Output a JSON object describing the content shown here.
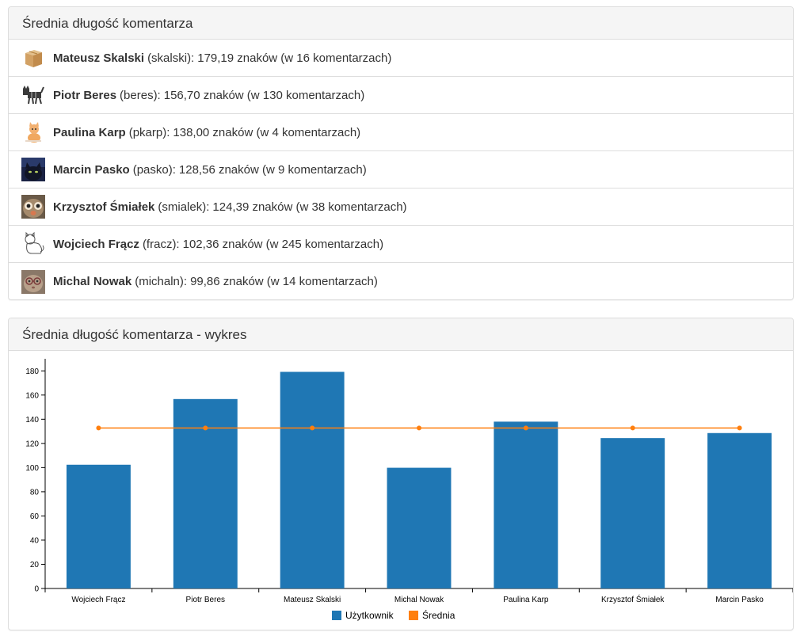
{
  "list_panel": {
    "title": "Średnia długość komentarza",
    "items": [
      {
        "name": "Mateusz Skalski",
        "login": "(skalski):",
        "stats": "179,19 znaków (w 16 komentarzach)",
        "avatar": "box-avatar-icon"
      },
      {
        "name": "Piotr Beres",
        "login": "(beres):",
        "stats": "156,70 znaków (w 130 komentarzach)",
        "avatar": "cat-avatar-icon"
      },
      {
        "name": "Paulina Karp",
        "login": "(pkarp):",
        "stats": "138,00 znaków (w 4 komentarzach)",
        "avatar": "kitten-avatar-icon"
      },
      {
        "name": "Marcin Pasko",
        "login": "(pasko):",
        "stats": "128,56 znaków (w 9 komentarzach)",
        "avatar": "dark-cat-avatar-icon"
      },
      {
        "name": "Krzysztof Śmiałek",
        "login": "(smialek):",
        "stats": "124,39 znaków (w 38 komentarzach)",
        "avatar": "owl-avatar-icon"
      },
      {
        "name": "Wojciech Frącz",
        "login": "(fracz):",
        "stats": "102,36 znaków (w 245 komentarzach)",
        "avatar": "sketch-cat-avatar-icon"
      },
      {
        "name": "Michal Nowak",
        "login": "(michaln):",
        "stats": "99,86 znaków (w 14 komentarzach)",
        "avatar": "glasses-cat-avatar-icon"
      }
    ]
  },
  "chart_panel": {
    "title": "Średnia długość komentarza - wykres"
  },
  "chart_data": {
    "type": "bar",
    "categories": [
      "Wojciech Frącz",
      "Piotr Beres",
      "Mateusz Skalski",
      "Michal Nowak",
      "Paulina Karp",
      "Krzysztof Śmiałek",
      "Marcin Pasko"
    ],
    "series": [
      {
        "name": "Użytkownik",
        "type": "bar",
        "color": "#1f77b4",
        "values": [
          102.36,
          156.7,
          179.19,
          99.86,
          138.0,
          124.39,
          128.56
        ]
      },
      {
        "name": "Średnia",
        "type": "line",
        "color": "#ff7f0e",
        "values": [
          132.72,
          132.72,
          132.72,
          132.72,
          132.72,
          132.72,
          132.72
        ]
      }
    ],
    "ylim": [
      0,
      190
    ],
    "yticks": [
      0,
      20,
      40,
      60,
      80,
      100,
      120,
      140,
      160,
      180
    ],
    "legend_position": "bottom",
    "grid": false
  }
}
